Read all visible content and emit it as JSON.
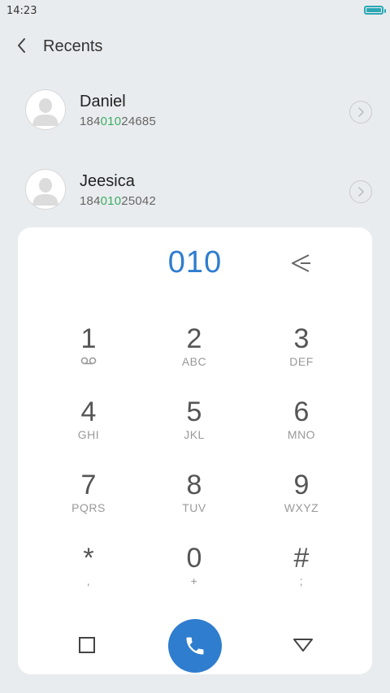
{
  "status_bar": {
    "time": "14:23",
    "battery_icon": "battery-full-icon",
    "battery_color": "#2ba8b4"
  },
  "header": {
    "title": "Recents",
    "back_icon": "chevron-left-icon"
  },
  "recents": [
    {
      "name": "Daniel",
      "number_prefix": "184",
      "number_match": "010",
      "number_suffix": "24685"
    },
    {
      "name": "Jeesica",
      "number_prefix": "184",
      "number_match": "010",
      "number_suffix": "25042"
    }
  ],
  "dialer": {
    "dialed_number": "010",
    "keys": [
      {
        "digit": "1",
        "letters": ""
      },
      {
        "digit": "2",
        "letters": "ABC"
      },
      {
        "digit": "3",
        "letters": "DEF"
      },
      {
        "digit": "4",
        "letters": "GHI"
      },
      {
        "digit": "5",
        "letters": "JKL"
      },
      {
        "digit": "6",
        "letters": "MNO"
      },
      {
        "digit": "7",
        "letters": "PQRS"
      },
      {
        "digit": "8",
        "letters": "TUV"
      },
      {
        "digit": "9",
        "letters": "WXYZ"
      },
      {
        "digit": "*",
        "letters": ","
      },
      {
        "digit": "0",
        "letters": "+"
      },
      {
        "digit": "#",
        "letters": ";"
      }
    ]
  },
  "colors": {
    "accent": "#2f7dce",
    "match_highlight": "#3cae62",
    "background": "#e9ecef"
  }
}
